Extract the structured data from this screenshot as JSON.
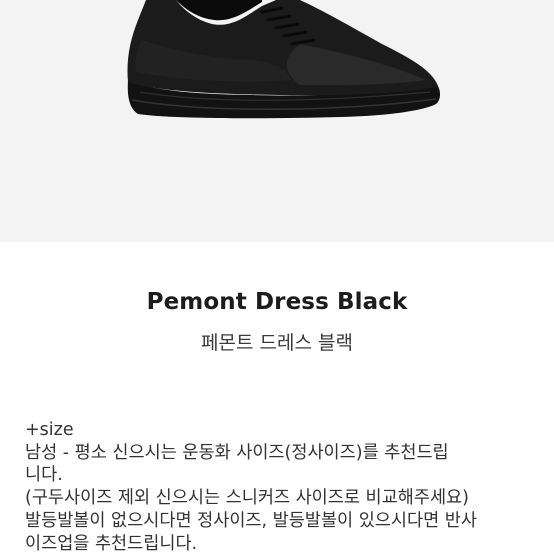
{
  "product": {
    "name": "Pemont Dress Black",
    "name_ko": "페몬트 드레스 블랙"
  },
  "description": {
    "lines": [
      "+size",
      "남성 - 평소 신으시는 운동화 사이즈(정사이즈)를 추천드립",
      "니다.",
      "(구두사이즈 제외 신으시는 스니커즈 사이즈로 비교해주세요)",
      "발등발볼이 없으시다면 정사이즈, 발등발볼이 있으시다면 반사",
      "이즈업을 추천드립니다."
    ]
  },
  "colors": {
    "hero_background": "#f3f3f3",
    "shoe": "#111111"
  },
  "icons": {
    "hero": "black-leather-sneaker"
  }
}
